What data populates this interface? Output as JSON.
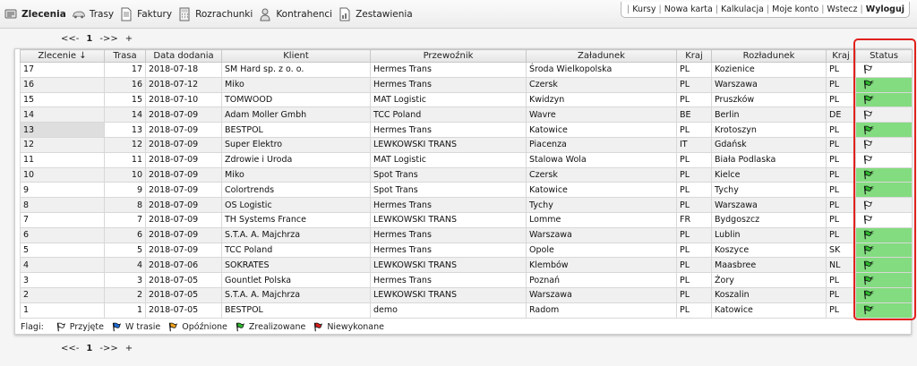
{
  "nav": [
    {
      "label": "Zlecenia",
      "icon": "orders-icon",
      "active": true
    },
    {
      "label": "Trasy",
      "icon": "car-icon",
      "active": false
    },
    {
      "label": "Faktury",
      "icon": "invoice-icon",
      "active": false
    },
    {
      "label": "Rozrachunki",
      "icon": "calculator-icon",
      "active": false
    },
    {
      "label": "Kontrahenci",
      "icon": "contacts-icon",
      "active": false
    },
    {
      "label": "Zestawienia",
      "icon": "report-icon",
      "active": false
    }
  ],
  "user_links": [
    {
      "label": "Kursy",
      "bold": false
    },
    {
      "label": "Nowa karta",
      "bold": false
    },
    {
      "label": "Kalkulacja",
      "bold": false
    },
    {
      "label": "Moje konto",
      "bold": false
    },
    {
      "label": "Wstecz",
      "bold": false
    },
    {
      "label": "Wyloguj",
      "bold": true
    }
  ],
  "pager": {
    "prev": "<<-",
    "current": "1",
    "next": "->>",
    "add": "+"
  },
  "columns": [
    "Zlecenie ↓",
    "Trasa",
    "Data dodania",
    "Klient",
    "Przewoźnik",
    "Załadunek",
    "Kraj",
    "Rozładunek",
    "Kraj",
    "Status"
  ],
  "rows": [
    {
      "zlecenie": "17",
      "trasa": "17",
      "data": "2018-07-18",
      "klient": "SM Hard sp. z o. o.",
      "przewoznik": "Hermes Trans",
      "zaladunek": "Środa Wielkopolska",
      "kraj1": "PL",
      "rozladunek": "Kozienice",
      "kraj2": "PL",
      "status": "przyjete",
      "green": false
    },
    {
      "zlecenie": "16",
      "trasa": "16",
      "data": "2018-07-12",
      "klient": "Miko",
      "przewoznik": "Hermes Trans",
      "zaladunek": "Czersk",
      "kraj1": "PL",
      "rozladunek": "Warszawa",
      "kraj2": "PL",
      "status": "zrealizowane",
      "green": true
    },
    {
      "zlecenie": "15",
      "trasa": "15",
      "data": "2018-07-10",
      "klient": "TOMWOOD",
      "przewoznik": "MAT Logistic",
      "zaladunek": "Kwidzyn",
      "kraj1": "PL",
      "rozladunek": "Pruszków",
      "kraj2": "PL",
      "status": "zrealizowane",
      "green": true
    },
    {
      "zlecenie": "14",
      "trasa": "14",
      "data": "2018-07-09",
      "klient": "Adam Moller Gmbh",
      "przewoznik": "TCC Poland",
      "zaladunek": "Wavre",
      "kraj1": "BE",
      "rozladunek": "Berlin",
      "kraj2": "DE",
      "status": "przyjete",
      "green": false
    },
    {
      "zlecenie": "13",
      "trasa": "13",
      "data": "2018-07-09",
      "klient": "BESTPOL",
      "przewoznik": "Hermes Trans",
      "zaladunek": "Katowice",
      "kraj1": "PL",
      "rozladunek": "Krotoszyn",
      "kraj2": "PL",
      "status": "zrealizowane",
      "green": true
    },
    {
      "zlecenie": "12",
      "trasa": "12",
      "data": "2018-07-09",
      "klient": "Super Elektro",
      "przewoznik": "LEWKOWSKI TRANS",
      "zaladunek": "Piacenza",
      "kraj1": "IT",
      "rozladunek": "Gdańsk",
      "kraj2": "PL",
      "status": "przyjete",
      "green": false
    },
    {
      "zlecenie": "11",
      "trasa": "11",
      "data": "2018-07-09",
      "klient": "Zdrowie i Uroda",
      "przewoznik": "MAT Logistic",
      "zaladunek": "Stalowa Wola",
      "kraj1": "PL",
      "rozladunek": "Biała Podlaska",
      "kraj2": "PL",
      "status": "przyjete",
      "green": false
    },
    {
      "zlecenie": "10",
      "trasa": "10",
      "data": "2018-07-09",
      "klient": "Miko",
      "przewoznik": "Spot Trans",
      "zaladunek": "Czersk",
      "kraj1": "PL",
      "rozladunek": "Kielce",
      "kraj2": "PL",
      "status": "zrealizowane",
      "green": true
    },
    {
      "zlecenie": "9",
      "trasa": "9",
      "data": "2018-07-09",
      "klient": "Colortrends",
      "przewoznik": "Spot Trans",
      "zaladunek": "Katowice",
      "kraj1": "PL",
      "rozladunek": "Tychy",
      "kraj2": "PL",
      "status": "zrealizowane",
      "green": true
    },
    {
      "zlecenie": "8",
      "trasa": "8",
      "data": "2018-07-09",
      "klient": "OS Logistic",
      "przewoznik": "Hermes Trans",
      "zaladunek": "Tychy",
      "kraj1": "PL",
      "rozladunek": "Warszawa",
      "kraj2": "PL",
      "status": "przyjete",
      "green": false
    },
    {
      "zlecenie": "7",
      "trasa": "7",
      "data": "2018-07-09",
      "klient": "TH Systems France",
      "przewoznik": "LEWKOWSKI TRANS",
      "zaladunek": "Lomme",
      "kraj1": "FR",
      "rozladunek": "Bydgoszcz",
      "kraj2": "PL",
      "status": "przyjete",
      "green": false
    },
    {
      "zlecenie": "6",
      "trasa": "6",
      "data": "2018-07-09",
      "klient": "S.T.A. A. Majchrza",
      "przewoznik": "Hermes Trans",
      "zaladunek": "Warszawa",
      "kraj1": "PL",
      "rozladunek": "Lublin",
      "kraj2": "PL",
      "status": "zrealizowane",
      "green": true
    },
    {
      "zlecenie": "5",
      "trasa": "5",
      "data": "2018-07-09",
      "klient": "TCC Poland",
      "przewoznik": "Hermes Trans",
      "zaladunek": "Opole",
      "kraj1": "PL",
      "rozladunek": "Koszyce",
      "kraj2": "SK",
      "status": "zrealizowane",
      "green": true
    },
    {
      "zlecenie": "4",
      "trasa": "4",
      "data": "2018-07-06",
      "klient": "SOKRATES",
      "przewoznik": "LEWKOWSKI TRANS",
      "zaladunek": "Klembów",
      "kraj1": "PL",
      "rozladunek": "Maasbree",
      "kraj2": "NL",
      "status": "zrealizowane",
      "green": true
    },
    {
      "zlecenie": "3",
      "trasa": "3",
      "data": "2018-07-05",
      "klient": "Gountlet Polska",
      "przewoznik": "Hermes Trans",
      "zaladunek": "Poznań",
      "kraj1": "PL",
      "rozladunek": "Żory",
      "kraj2": "PL",
      "status": "zrealizowane",
      "green": true
    },
    {
      "zlecenie": "2",
      "trasa": "2",
      "data": "2018-07-05",
      "klient": "S.T.A. A. Majchrza",
      "przewoznik": "LEWKOWSKI TRANS",
      "zaladunek": "Warszawa",
      "kraj1": "PL",
      "rozladunek": "Koszalin",
      "kraj2": "PL",
      "status": "zrealizowane",
      "green": true
    },
    {
      "zlecenie": "1",
      "trasa": "1",
      "data": "2018-07-05",
      "klient": "BESTPOL",
      "przewoznik": "demo",
      "zaladunek": "Radom",
      "kraj1": "PL",
      "rozladunek": "Katowice",
      "kraj2": "PL",
      "status": "zrealizowane",
      "green": true
    }
  ],
  "legend": {
    "label": "Flagi:",
    "items": [
      {
        "label": "Przyjęte",
        "flag": "przyjete"
      },
      {
        "label": "W trasie",
        "flag": "w_trasie"
      },
      {
        "label": "Opóźnione",
        "flag": "opoznione"
      },
      {
        "label": "Zrealizowane",
        "flag": "zrealizowane"
      },
      {
        "label": "Niewykonane",
        "flag": "niewykonane"
      }
    ]
  },
  "flag_colors": {
    "przyjete": "#ffffff",
    "w_trasie": "#1e6bd6",
    "opoznione": "#f0a21c",
    "zrealizowane": "#2eb82e",
    "niewykonane": "#d81e1e"
  },
  "colors": {
    "status_green": "#83dc7f",
    "highlight": "#e0221c"
  }
}
